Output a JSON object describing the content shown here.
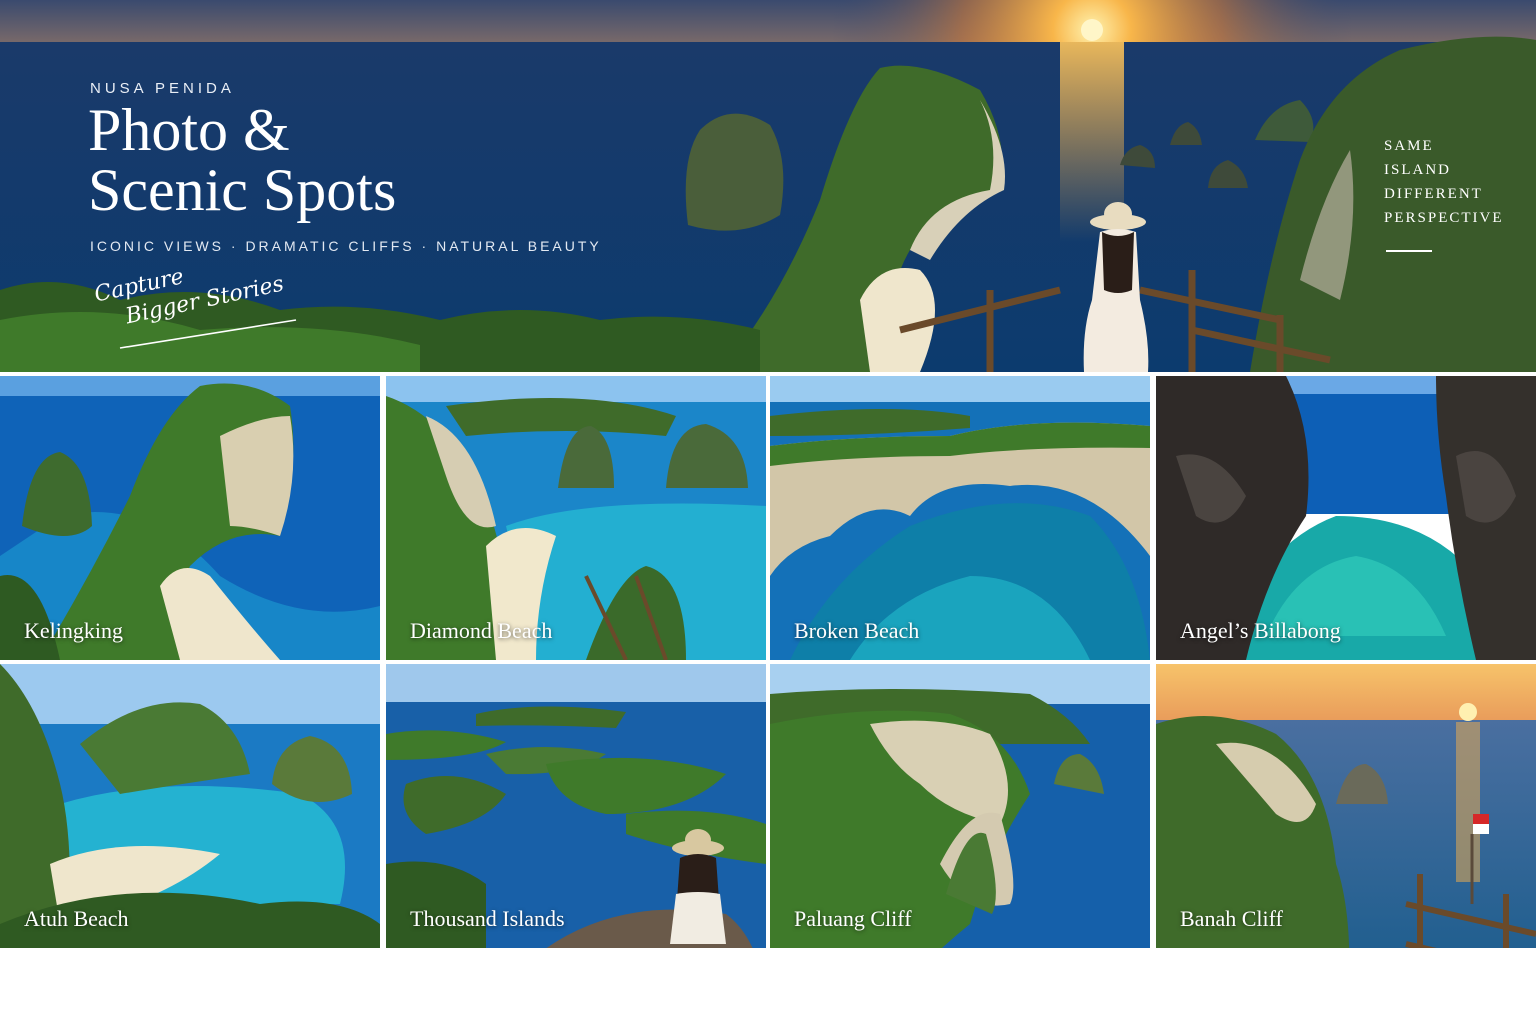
{
  "hero": {
    "eyebrow": "NUSA PENIDA",
    "title_line1": "Photo &",
    "title_line2": "Scenic Spots",
    "tagline": "ICONIC VIEWS  ·  DRAMATIC CLIFFS  ·  NATURAL BEAUTY",
    "script_line1": "Capture",
    "script_line2": "Bigger Stories",
    "side_note": [
      "SAME",
      "ISLAND",
      "DIFFERENT",
      "PERSPECTIVE"
    ]
  },
  "spots": [
    {
      "label": "Kelingking"
    },
    {
      "label": "Diamond Beach"
    },
    {
      "label": "Broken Beach"
    },
    {
      "label": "Angel’s Billabong"
    },
    {
      "label": "Atuh Beach"
    },
    {
      "label": "Thousand Islands"
    },
    {
      "label": "Paluang Cliff"
    },
    {
      "label": "Banah Cliff"
    }
  ],
  "colors": {
    "ocean": "#0e3a70",
    "sunset": "#f5a23a",
    "cliff_green": "#3f6b2a",
    "lagoon": "#1fb3c8"
  }
}
